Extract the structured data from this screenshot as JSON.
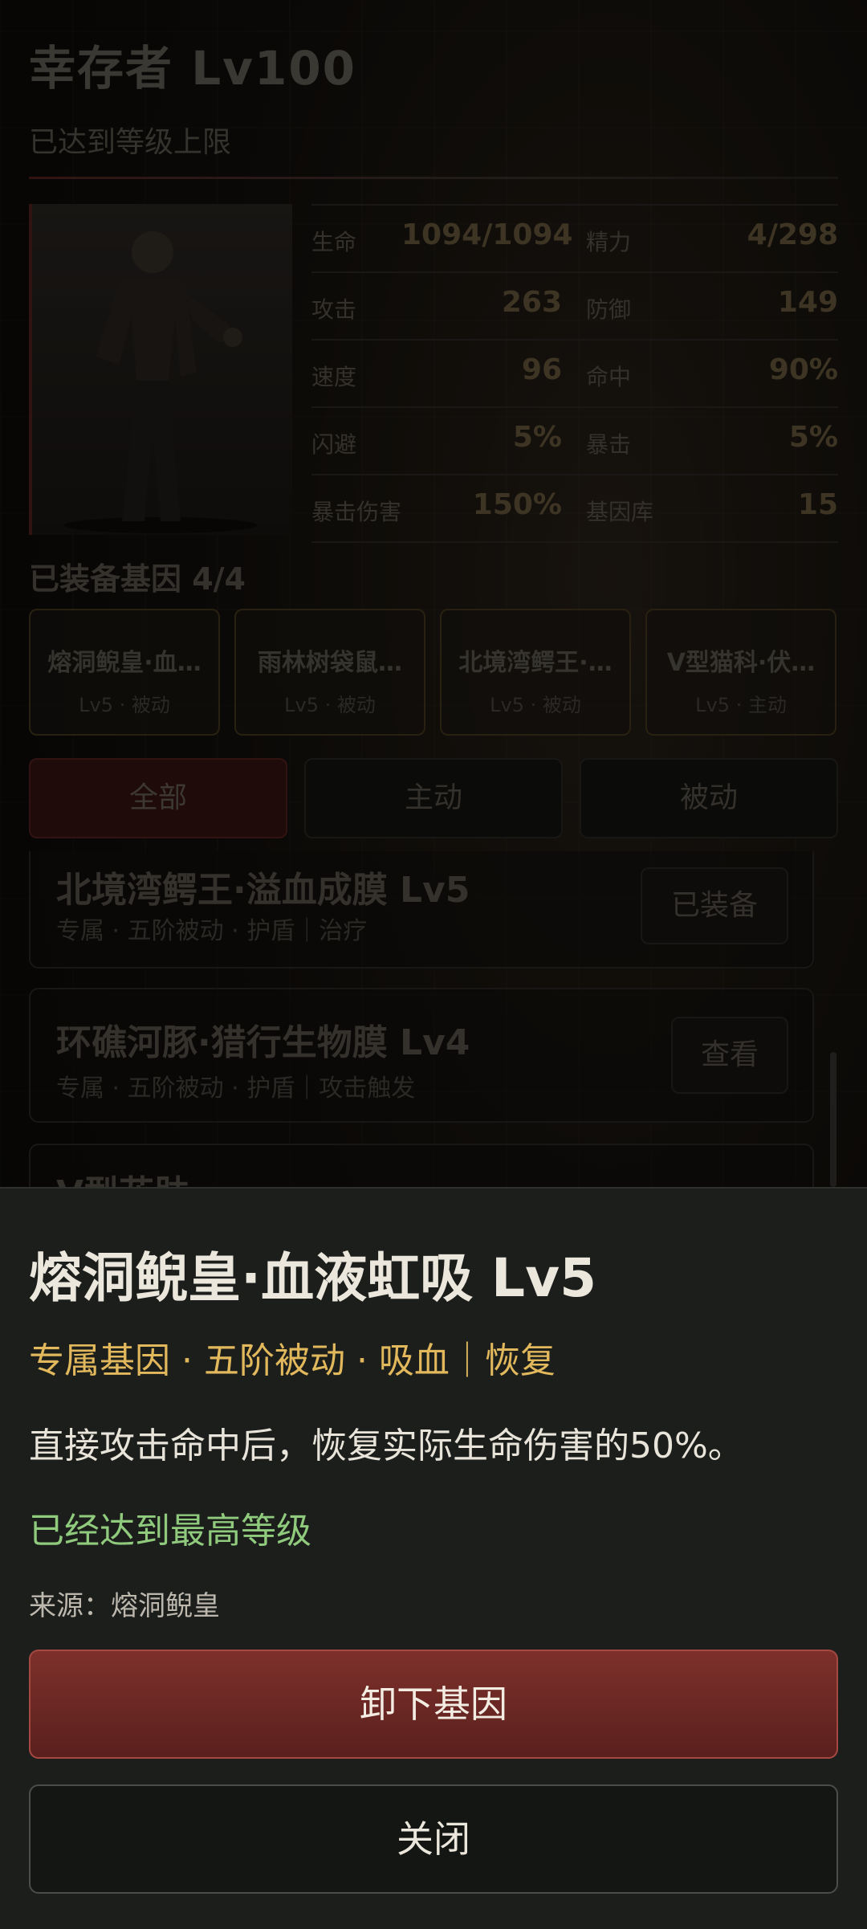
{
  "header": {
    "title": "幸存者 Lv100",
    "subtitle": "已达到等级上限"
  },
  "stats": [
    {
      "l1": "生命",
      "v1": "1094/1094",
      "l2": "精力",
      "v2": "4/298"
    },
    {
      "l1": "攻击",
      "v1": "263",
      "l2": "防御",
      "v2": "149"
    },
    {
      "l1": "速度",
      "v1": "96",
      "l2": "命中",
      "v2": "90%"
    },
    {
      "l1": "闪避",
      "v1": "5%",
      "l2": "暴击",
      "v2": "5%"
    },
    {
      "l1": "暴击伤害",
      "v1": "150%",
      "l2": "基因库",
      "v2": "15"
    }
  ],
  "equipped": {
    "title": "已装备基因 4/4",
    "cards": [
      {
        "name": "熔洞鲵皇·血…",
        "level": "Lv5 · 被动"
      },
      {
        "name": "雨林树袋鼠…",
        "level": "Lv5 · 被动"
      },
      {
        "name": "北境湾鳄王·…",
        "level": "Lv5 · 被动"
      },
      {
        "name": "V型猫科·伏…",
        "level": "Lv5 · 主动"
      }
    ]
  },
  "tabs": [
    "全部",
    "主动",
    "被动"
  ],
  "gene_list": [
    {
      "name": "北境湾鳄王·溢血成膜 Lv5",
      "meta": "专属 · 五阶被动 · 护盾｜治疗",
      "button": "已装备"
    },
    {
      "name": "环礁河豚·猎行生物膜 Lv4",
      "meta": "专属 · 五阶被动 · 护盾｜攻击触发",
      "button": "查看"
    },
    {
      "name": "V型花肤",
      "meta": "",
      "button": ""
    }
  ],
  "sheet": {
    "title": "熔洞鲵皇·血液虹吸 Lv5",
    "tags": "专属基因 · 五阶被动 · 吸血｜恢复",
    "description": "直接攻击命中后，恢复实际生命伤害的50%。",
    "max_level": "已经达到最高等级",
    "source": "来源：熔洞鲵皇",
    "unequip_label": "卸下基因",
    "close_label": "关闭"
  },
  "colors": {
    "accent_red": "#7d302b",
    "tag_gold": "#e2b85c",
    "max_green": "#8fca7d"
  }
}
